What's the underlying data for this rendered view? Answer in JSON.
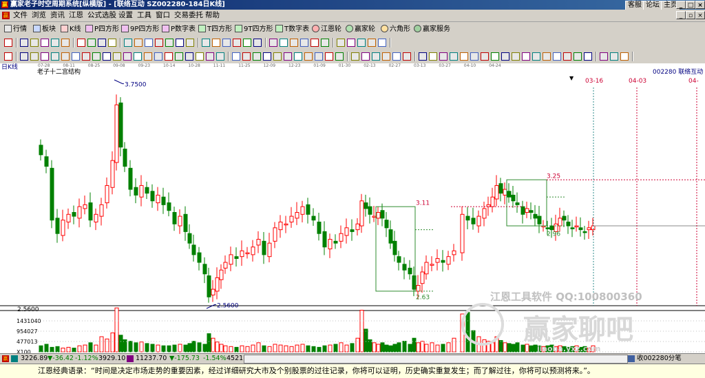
{
  "window": {
    "title": "赢家老子时空周期系统[纵横版] - [联络互动  SZ002280-184日K线]",
    "app_icon": "赢",
    "links": [
      "客服",
      "论坛",
      "主页"
    ],
    "buttons": [
      "_",
      "□",
      "×"
    ]
  },
  "menu": {
    "logo": "赢",
    "items": [
      "文件",
      "浏览",
      "资讯",
      "江恩",
      "公式选股",
      "设置",
      "工具",
      "窗口",
      "交易委托",
      "帮助"
    ],
    "right_buttons": [
      "_",
      "▫",
      "×"
    ]
  },
  "toolbar1": {
    "items": [
      "行情",
      "板块",
      "K线",
      "P四方形",
      "9P四方形",
      "P数字表",
      "T四方形",
      "9T四方形",
      "T数字表",
      "江恩轮",
      "赢家轮",
      "六角形",
      "赢家服务"
    ]
  },
  "chart": {
    "timeframe_label": "日K线",
    "indicator_label": "老子十二宫结构",
    "stock_label": "002280  联络互动",
    "dates": [
      "07-28",
      "08-11",
      "08-25",
      "09-08",
      "09-23",
      "10-14",
      "10-28",
      "11-11",
      "11-25",
      "12-09",
      "12-23",
      "01-09",
      "01-30",
      "02-13",
      "02-27",
      "03-13",
      "03-27",
      "04-10",
      "04-24"
    ],
    "future_dates": [
      "03-16",
      "04-03",
      "04-"
    ],
    "price_labels": {
      "high": "3.7500",
      "low": "2.5600",
      "axis_low": "2.5600",
      "box1_top": "3.11",
      "box1_bottom": "2.63",
      "box2_top": "3.25",
      "box2_bottom": "2.96"
    },
    "volume_axis": [
      "1431040",
      "954027",
      "477013",
      "X100"
    ],
    "colors": {
      "up": "#ff0000",
      "down": "#008000",
      "box": "#2e8b2e",
      "target": "#cc0033"
    }
  },
  "watermark": {
    "brand": "江恩工具软件  QQ:100800360",
    "big": "赢家聊吧",
    "url": "jiaoba.yxz.com"
  },
  "status": {
    "index1": "3226.89",
    "index1_change": "▼-36.42",
    "index1_pct": "-1.12%",
    "index1_amount": "3929.10",
    "index2": "11237.70",
    "index2_change": "▼-175.73",
    "index2_pct": "-1.54%",
    "index2_amount": "4521",
    "right_text": "收002280分笔"
  },
  "bottom": {
    "quote": "江恩经典语录：“时间是决定市场走势的重要因素，经过详细研究大市及个别股票的过往记录，你将可以证明，历史确实重复发生；而了解过往，你将可以预测将来。”。"
  }
}
